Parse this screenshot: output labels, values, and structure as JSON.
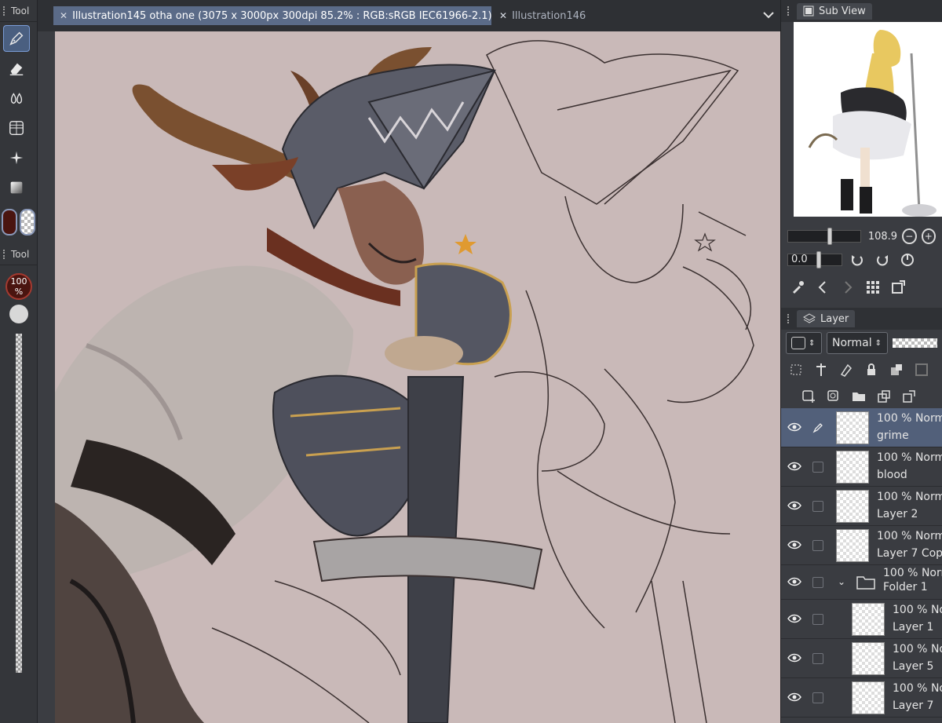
{
  "tool_panel": {
    "title": "Tool",
    "title_2": "Tool",
    "tools": [
      "pen-icon",
      "eraser-icon",
      "blend-icon",
      "grid-icon",
      "sparkle-icon",
      "gradient-icon"
    ],
    "brush_opacity": "100 %",
    "main_color": "#4a1510"
  },
  "tabs": [
    {
      "label": "Illustration145 otha one (3075 x 3000px 300dpi 85.2% : RGB:sRGB IEC61966-2.1)"
    },
    {
      "label": "Illustration146"
    }
  ],
  "subview": {
    "title": "Sub View",
    "zoom_value": "108.9",
    "rotation_value": "0.0"
  },
  "layer_panel": {
    "title": "Layer",
    "blend_mode": "Normal",
    "layers": [
      {
        "opacity": "100 %",
        "mode": "Norm",
        "name": "grime"
      },
      {
        "opacity": "100 %",
        "mode": "Norm",
        "name": "blood"
      },
      {
        "opacity": "100 %",
        "mode": "Norm",
        "name": "Layer 2"
      },
      {
        "opacity": "100 %",
        "mode": "Norm",
        "name": "Layer 7 Copy"
      },
      {
        "opacity": "100 %",
        "mode": "Norm",
        "name": "Folder 1"
      },
      {
        "opacity": "100 %",
        "mode": "No",
        "name": "Layer 1"
      },
      {
        "opacity": "100 %",
        "mode": "No",
        "name": "Layer 5"
      },
      {
        "opacity": "100 %",
        "mode": "No",
        "name": "Layer 7"
      }
    ]
  },
  "colors": {
    "canvas_bg": "#c9b9b8",
    "accent": "#5b6b88",
    "selected_layer": "#52607a"
  }
}
